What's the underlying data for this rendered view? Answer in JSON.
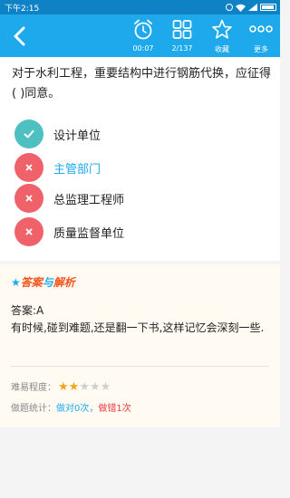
{
  "status_bar": {
    "time": "下午2:15"
  },
  "toolbar": {
    "timer": "00:07",
    "progress": "2/137",
    "favorite": "收藏",
    "more": "更多"
  },
  "question": {
    "text": "对于水利工程，重要结构中进行钢筋代换，应征得(   )同意。",
    "options": [
      {
        "label": "设计单位",
        "state": "correct"
      },
      {
        "label": "主管部门",
        "state": "wrong-selected"
      },
      {
        "label": "总监理工程师",
        "state": "wrong"
      },
      {
        "label": "质量监督单位",
        "state": "wrong"
      }
    ]
  },
  "analysis": {
    "title_star": "★",
    "title_answer": "答案",
    "title_and": "与",
    "title_analysis": "解析",
    "answer_line": "答案:A",
    "explanation": "有时候,碰到难题,还是翻一下书,这样记忆会深刻一些.",
    "difficulty_label": "难易程度：",
    "difficulty_rating": 2,
    "difficulty_max": 5,
    "stats_label": "做题统计：",
    "stats_correct": "做对0次",
    "stats_sep": "，",
    "stats_wrong": "做错1次"
  },
  "colors": {
    "accent": "#1da9ec",
    "correct": "#4fc0c2",
    "wrong": "#f0626a"
  }
}
